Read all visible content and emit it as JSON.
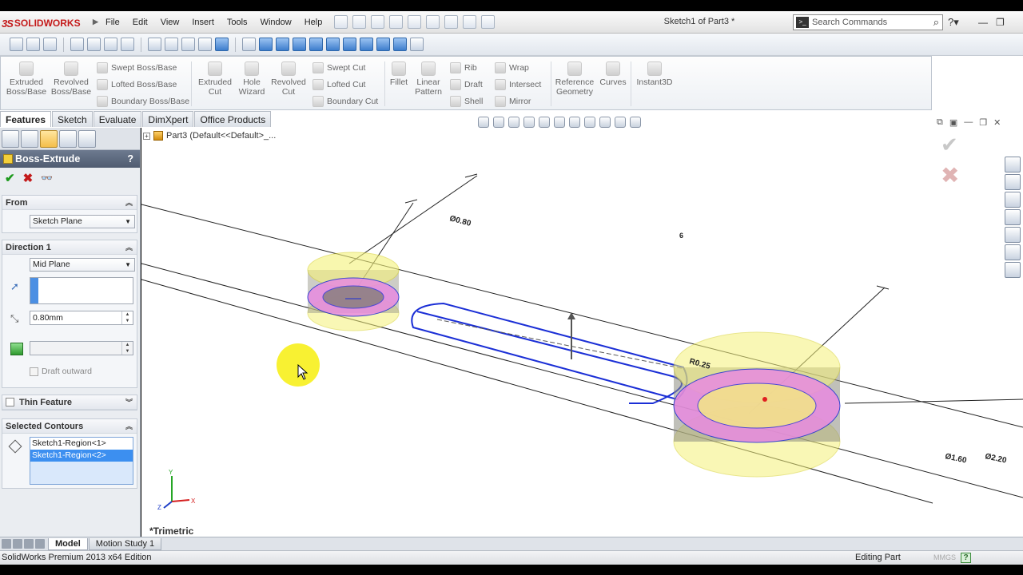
{
  "app": {
    "logo_text": "SOLIDWORKS",
    "document_title": "Sketch1 of Part3 *"
  },
  "menu": [
    "File",
    "Edit",
    "View",
    "Insert",
    "Tools",
    "Window",
    "Help"
  ],
  "search": {
    "placeholder": "Search Commands"
  },
  "command_manager": {
    "extruded_boss": "Extruded\nBoss/Base",
    "revolved_boss": "Revolved\nBoss/Base",
    "swept_boss": "Swept Boss/Base",
    "lofted_boss": "Lofted Boss/Base",
    "boundary_boss": "Boundary Boss/Base",
    "extruded_cut": "Extruded\nCut",
    "hole_wizard": "Hole\nWizard",
    "revolved_cut": "Revolved\nCut",
    "swept_cut": "Swept Cut",
    "lofted_cut": "Lofted Cut",
    "boundary_cut": "Boundary Cut",
    "fillet": "Fillet",
    "linear_pattern": "Linear\nPattern",
    "rib": "Rib",
    "draft": "Draft",
    "shell": "Shell",
    "wrap": "Wrap",
    "intersect": "Intersect",
    "mirror": "Mirror",
    "reference_geometry": "Reference\nGeometry",
    "curves": "Curves",
    "instant3d": "Instant3D"
  },
  "tabs": [
    "Features",
    "Sketch",
    "Evaluate",
    "DimXpert",
    "Office Products"
  ],
  "property_manager": {
    "title": "Boss-Extrude",
    "help": "?",
    "from": {
      "label": "From",
      "value": "Sketch Plane"
    },
    "direction1": {
      "label": "Direction 1",
      "end_condition": "Mid Plane",
      "depth": "0.80mm",
      "draft_outward": "Draft outward"
    },
    "thin_feature": "Thin Feature",
    "selected_contours": {
      "label": "Selected Contours",
      "items": [
        "Sketch1-Region<1>",
        "Sketch1-Region<2>"
      ]
    }
  },
  "graphics": {
    "tree_item": "Part3  (Default<<Default>_...",
    "view_orientation": "*Trimetric",
    "dimensions": {
      "dim_top": "Ø0.80",
      "radius": "R0.25",
      "dia_1": "Ø1.60",
      "dia_2": "Ø2.20",
      "small_mark": "6"
    },
    "triad": {
      "x": "X",
      "y": "Y",
      "z": "Z"
    }
  },
  "bottom_tabs": [
    "Model",
    "Motion Study 1"
  ],
  "status": {
    "edition": "SolidWorks Premium 2013 x64 Edition",
    "mode": "Editing Part",
    "units": "MMGS"
  },
  "colors": {
    "sketch_blue": "#1b2fd6",
    "region_pink": "#e88be0",
    "region_yellow": "#f5f27a",
    "cursor_highlight": "#f7ef1c",
    "pm_header": "#5b677c"
  }
}
